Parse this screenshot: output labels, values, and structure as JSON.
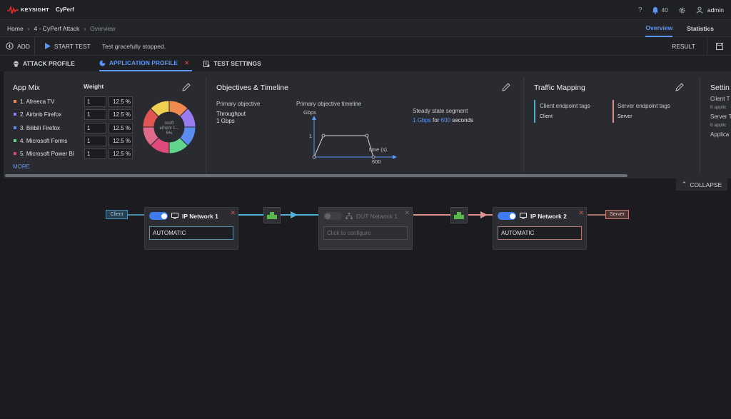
{
  "header": {
    "brand": "KEYSIGHT",
    "product": "CyPerf",
    "help_icon": "help-icon",
    "notifications_count": "40",
    "user": "admin"
  },
  "breadcrumb": {
    "home": "Home",
    "session": "4 - CyPerf Attack",
    "page": "Overview"
  },
  "view_tabs": {
    "overview": "Overview",
    "statistics": "Statistics"
  },
  "toolbar": {
    "add_label": "ADD",
    "start_label": "START TEST",
    "status": "Test gracefully stopped.",
    "result_label": "RESULT"
  },
  "profile_tabs": {
    "attack": "ATTACK PROFILE",
    "application": "APPLICATION PROFILE",
    "settings": "TEST SETTINGS"
  },
  "app_mix": {
    "title": "App Mix",
    "weight_header": "Weight",
    "apps": [
      {
        "name": "1. Afreeca TV",
        "weight": "1",
        "percent": "12.5 %",
        "color": "#f0894f"
      },
      {
        "name": "2. Airbnb Firefox",
        "weight": "1",
        "percent": "12.5 %",
        "color": "#9b7cf0"
      },
      {
        "name": "3. Bilibili Firefox",
        "weight": "1",
        "percent": "12.5 %",
        "color": "#5b8df0"
      },
      {
        "name": "4. Microsoft Forms",
        "weight": "1",
        "percent": "12.5 %",
        "color": "#5fd48a"
      },
      {
        "name": "5. Microsoft Power BI",
        "weight": "1",
        "percent": "12.5 %",
        "color": "#e04a7a"
      }
    ],
    "more_label": "MORE",
    "donut_colors": [
      "#f0894f",
      "#9b7cf0",
      "#5b8df0",
      "#5fd48a",
      "#e04a7a",
      "#e06a8a",
      "#e25555",
      "#f0d050"
    ],
    "donut_center_text": [
      "osoft",
      "ePoint 1...",
      "5%"
    ]
  },
  "objectives": {
    "title": "Objectives & Timeline",
    "primary_label": "Primary objective",
    "primary_type": "Throughput",
    "primary_value": "1 Gbps",
    "timeline_label": "Primary objective timeline",
    "y_unit": "Gbps",
    "y_tick": "1",
    "x_label": "time (s)",
    "x_tick": "600",
    "steady_label": "Steady state segment",
    "steady_value": "1",
    "steady_unit": "Gbps",
    "steady_for": "for",
    "steady_seconds": "600",
    "steady_suffix": "seconds"
  },
  "traffic_mapping": {
    "title": "Traffic Mapping",
    "client_label": "Client endpoint tags",
    "client_value": "Client",
    "server_label": "Server endpoint tags",
    "server_value": "Server"
  },
  "settings_panel": {
    "title": "Settin",
    "line1": "Client T",
    "line2": "8 applic",
    "line3": "Server T",
    "line4": "8 applic",
    "line5": "Applica"
  },
  "canvas": {
    "collapse_label": "COLLAPSE",
    "client_tag": "Client",
    "server_tag": "Server",
    "network1": {
      "name": "IP Network 1",
      "field": "AUTOMATIC"
    },
    "dut": {
      "name": "DUT Network 1",
      "field": "Click to configure"
    },
    "network2": {
      "name": "IP Network 2",
      "field": "AUTOMATIC"
    }
  },
  "colors": {
    "accent": "#5b95f5",
    "client_line": "#4fb3d9",
    "server_line": "#e0938c",
    "close_red": "#d9534f",
    "connector_green": "#5ab84f"
  }
}
